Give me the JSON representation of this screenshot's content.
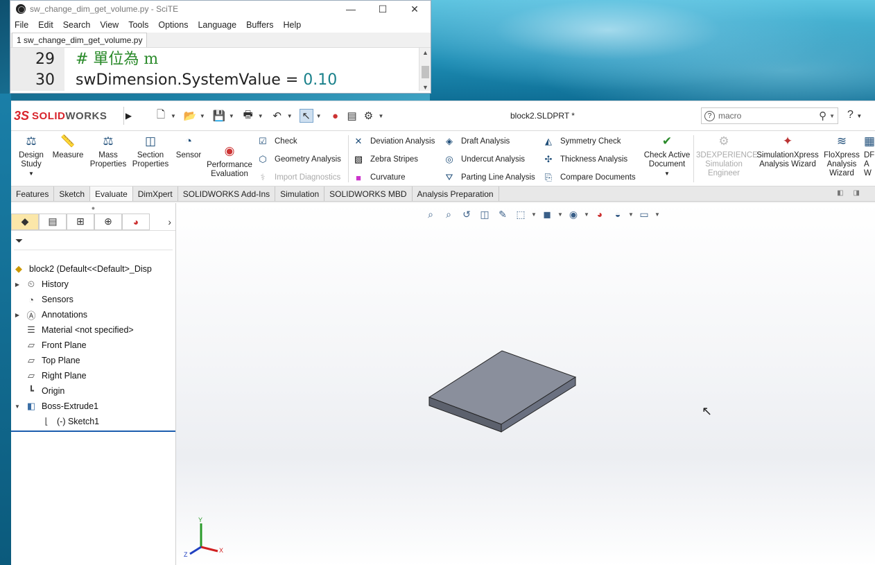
{
  "scite": {
    "title": "sw_change_dim_get_volume.py - SciTE",
    "menu": [
      "File",
      "Edit",
      "Search",
      "View",
      "Tools",
      "Options",
      "Language",
      "Buffers",
      "Help"
    ],
    "tab": "1 sw_change_dim_get_volume.py",
    "lines": [
      {
        "num": "29",
        "comment": "# 單位為 m"
      },
      {
        "num": "30",
        "code_pre": "swDimension.SystemValue = ",
        "code_num": "0.10"
      }
    ],
    "window_buttons": [
      "—",
      "☐",
      "✕"
    ]
  },
  "sw": {
    "logo_ds": "3S",
    "logo_brand_a": "SOLID",
    "logo_brand_b": "WORKS",
    "doc_title": "block2.SLDPRT *",
    "search_placeholder": "macro",
    "help": "?",
    "ribbon": {
      "design_study": "Design Study",
      "measure": "Measure",
      "mass_properties": "Mass Properties",
      "section_properties": "Section Properties",
      "sensor": "Sensor",
      "performance_evaluation": "Performance Evaluation",
      "check": "Check",
      "geometry_analysis": "Geometry Analysis",
      "import_diagnostics": "Import Diagnostics",
      "deviation_analysis": "Deviation Analysis",
      "zebra_stripes": "Zebra Stripes",
      "curvature": "Curvature",
      "draft_analysis": "Draft Analysis",
      "undercut_analysis": "Undercut Analysis",
      "parting_line_analysis": "Parting Line Analysis",
      "symmetry_check": "Symmetry Check",
      "thickness_analysis": "Thickness Analysis",
      "compare_documents": "Compare Documents",
      "check_active_document": "Check Active Document",
      "3dx_sim": "3DEXPERIENCE Simulation Engineer",
      "simxpress": "SimulationXpress Analysis Wizard",
      "floxpress": "FloXpress Analysis Wizard",
      "dfm_cut": "DF A W"
    },
    "tabs": [
      "Features",
      "Sketch",
      "Evaluate",
      "DimXpert",
      "SOLIDWORKS Add-Ins",
      "Simulation",
      "SOLIDWORKS MBD",
      "Analysis Preparation"
    ],
    "active_tab": "Evaluate",
    "tree": [
      {
        "label": "block2  (Default<<Default>_Disp",
        "icon": "part-icon",
        "arrow": ""
      },
      {
        "label": "History",
        "icon": "history-icon",
        "arrow": "▶"
      },
      {
        "label": "Sensors",
        "icon": "sensor-icon",
        "arrow": ""
      },
      {
        "label": "Annotations",
        "icon": "annotation-icon",
        "arrow": "▶"
      },
      {
        "label": "Material <not specified>",
        "icon": "material-icon",
        "arrow": ""
      },
      {
        "label": "Front Plane",
        "icon": "plane-icon",
        "arrow": ""
      },
      {
        "label": "Top Plane",
        "icon": "plane-icon",
        "arrow": ""
      },
      {
        "label": "Right Plane",
        "icon": "plane-icon",
        "arrow": ""
      },
      {
        "label": "Origin",
        "icon": "origin-icon",
        "arrow": ""
      },
      {
        "label": "Boss-Extrude1",
        "icon": "extrude-icon",
        "arrow": "▼"
      },
      {
        "label": "(-) Sketch1",
        "icon": "sketch-icon",
        "arrow": ""
      }
    ],
    "triad": {
      "x": "X",
      "y": "Y",
      "z": "Z"
    },
    "colors": {
      "accent": "#d8242c",
      "selection": "#1b5dae",
      "model_top": "#8a8f9c",
      "model_side": "#5c616d"
    }
  }
}
